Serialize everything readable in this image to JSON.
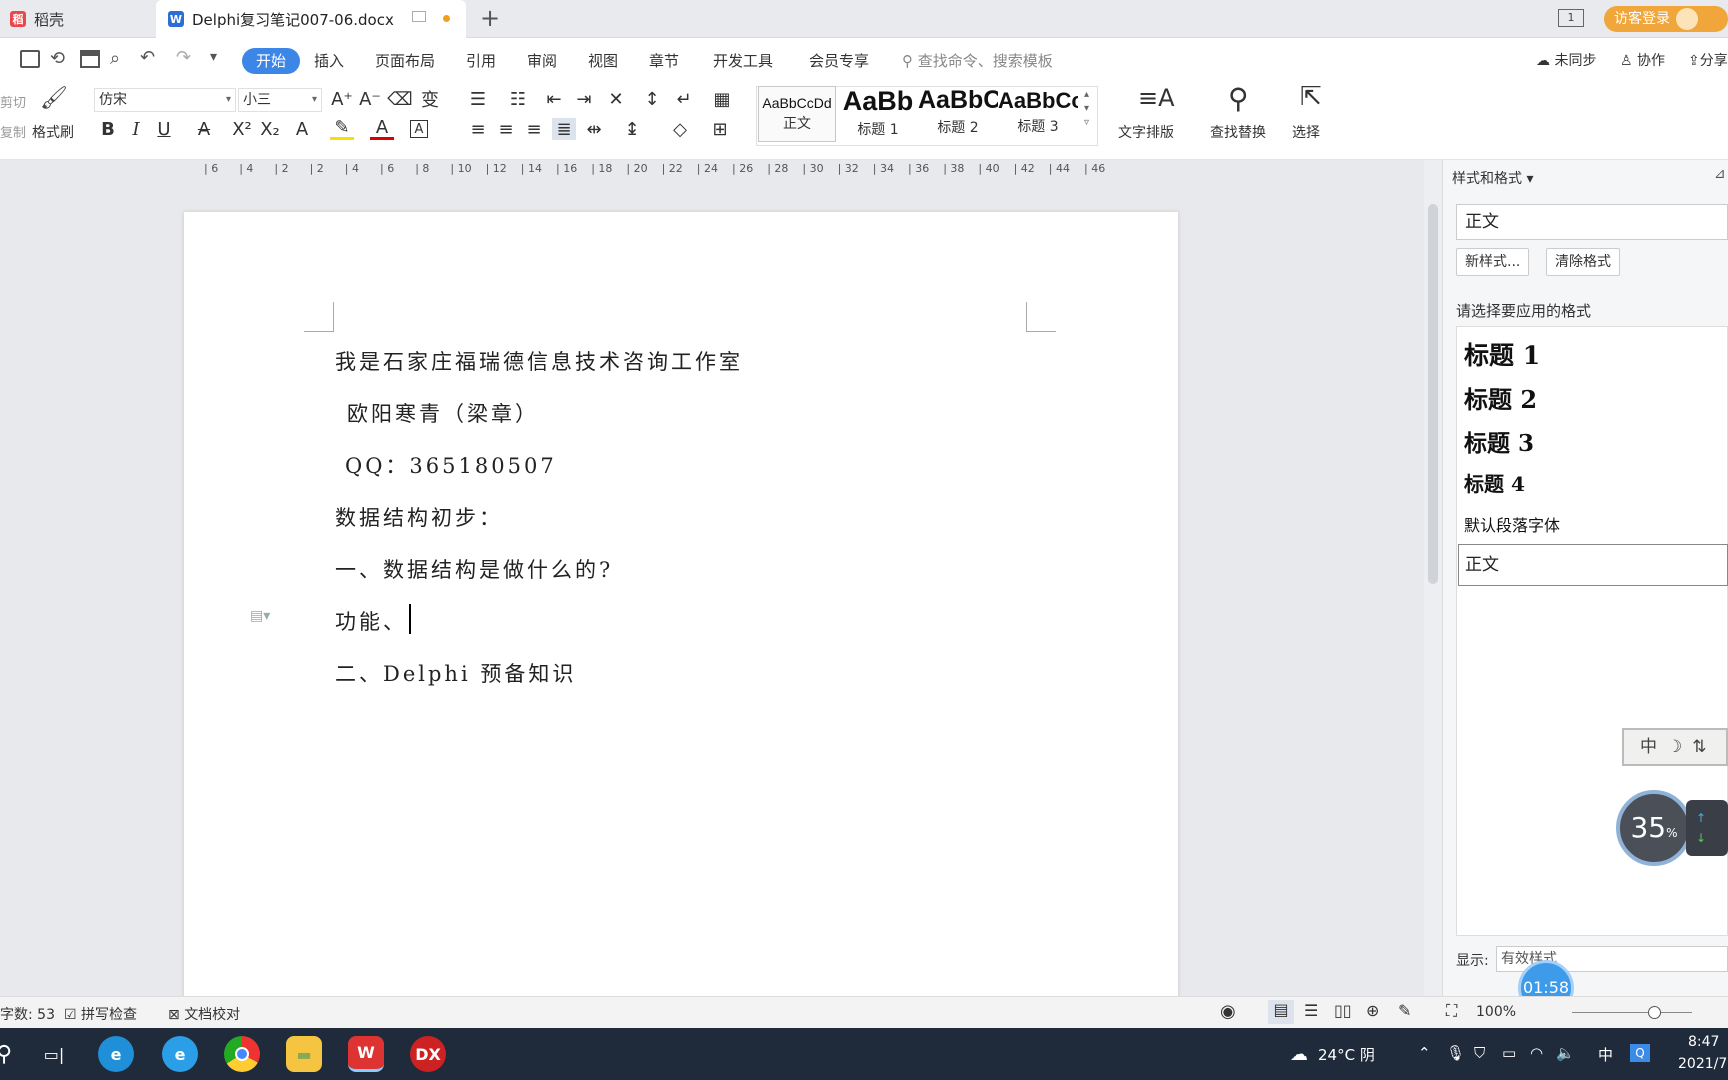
{
  "tabs": [
    {
      "label": "稻壳"
    },
    {
      "label": "Delphi复习笔记007-06.docx"
    }
  ],
  "titlebar": {
    "badge": "1",
    "login_label": "访客登录"
  },
  "menu": {
    "items": [
      "开始",
      "插入",
      "页面布局",
      "引用",
      "审阅",
      "视图",
      "章节",
      "开发工具",
      "会员专享"
    ],
    "search_placeholder": "查找命令、搜索模板",
    "sync_label": "未同步",
    "collab_label": "协作",
    "share_label": "分享"
  },
  "ribbon": {
    "cut": "剪切",
    "copy": "复制",
    "format_painter": "格式刷",
    "font_name": "仿宋",
    "font_size": "小三",
    "text_layout": "文字排版",
    "find_replace": "查找替换",
    "select": "选择",
    "styles": [
      {
        "preview": "AaBbCcDd",
        "label": "正文"
      },
      {
        "preview": "AaBb",
        "label": "标题 1"
      },
      {
        "preview": "AaBbC",
        "label": "标题 2"
      },
      {
        "preview": "AaBbCc",
        "label": "标题 3"
      }
    ]
  },
  "ruler": [
    "6",
    "4",
    "2",
    "2",
    "4",
    "6",
    "8",
    "10",
    "12",
    "14",
    "16",
    "18",
    "20",
    "22",
    "24",
    "26",
    "28",
    "30",
    "32",
    "34",
    "36",
    "38",
    "40",
    "42",
    "44",
    "46"
  ],
  "document": {
    "lines": [
      "我是石家庄福瑞德信息技术咨询工作室",
      "欧阳寒青（梁章）",
      "QQ：365180507",
      "数据结构初步：",
      "一、数据结构是做什么的?",
      "功能、",
      "二、Delphi 预备知识"
    ]
  },
  "styles_panel": {
    "title": "样式和格式",
    "current_style": "正文",
    "new_style": "新样式...",
    "clear_format": "清除格式",
    "apply_label": "请选择要应用的格式",
    "list": [
      "标题  1",
      "标题  2",
      "标题  3",
      "标题  4",
      "默认段落字体",
      "正文"
    ],
    "show_label": "显示:",
    "show_value": "有效样式"
  },
  "overlay": {
    "ime_text": "中",
    "percent": "35",
    "percent_unit": "%",
    "timer": "01:58"
  },
  "status": {
    "word_count": "字数: 53",
    "spell_check": "拼写检查",
    "doc_proof": "文档校对",
    "zoom": "100%"
  },
  "taskbar": {
    "weather": "24°C  阴",
    "ime": "中",
    "time": "8:47",
    "date": "2021/7"
  }
}
